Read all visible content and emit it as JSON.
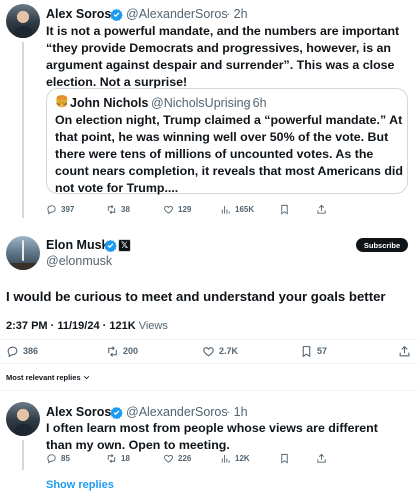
{
  "tweet1": {
    "name": "Alex Soros",
    "handle": "@AlexanderSoros",
    "time": "· 2h",
    "text": "It is not a powerful mandate, and the numbers are important “they provide Democrats and progressives, however, is an argument against despair and surrender”. This was a close election. Not a surprise!",
    "quote": {
      "emoji": "🍔",
      "name": "John Nichols",
      "handle": "@NicholsUprising",
      "time": "· 6h",
      "text": "On election night, Trump claimed a “powerful mandate.” At that point, he was winning well over 50% of the vote. But there were tens of millions of uncounted votes. As the count nears completion, it reveals that  most Americans did not vote for Trump...."
    },
    "stats": {
      "replies": "397",
      "reposts": "38",
      "likes": "129",
      "views": "165K"
    }
  },
  "tweet2": {
    "name": "Elon Musk",
    "handle": "@elonmusk",
    "subscribe_label": "Subscribe",
    "text": "I would be curious to meet and understand your goals better",
    "time": "2:37 PM",
    "date": "11/19/24",
    "views_count": "121K",
    "views_label": "Views",
    "stats": {
      "replies": "386",
      "reposts": "200",
      "likes": "2.7K",
      "bookmarks": "57"
    }
  },
  "replies_sort": "Most relevant replies",
  "tweet3": {
    "name": "Alex Soros",
    "handle": "@AlexanderSoros",
    "time": "· 1h",
    "text": "I often learn most from people whose views are different than my own. Open to meeting.",
    "stats": {
      "replies": "85",
      "reposts": "18",
      "likes": "226",
      "views": "12K"
    }
  },
  "show_replies": "Show replies",
  "colors": {
    "verified": "#1d9bf0",
    "secondary": "#536471",
    "link": "#1d9bf0"
  },
  "icons": [
    "reply-icon",
    "repost-icon",
    "like-icon",
    "views-icon",
    "bookmark-icon",
    "share-icon",
    "verified-badge-icon",
    "x-affiliate-icon",
    "chevron-down-icon"
  ]
}
